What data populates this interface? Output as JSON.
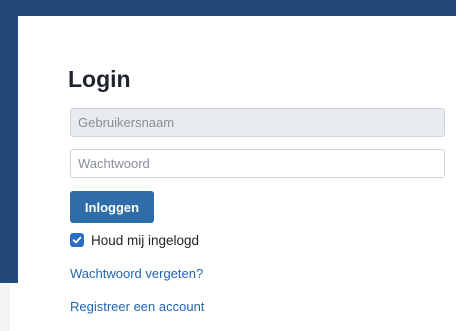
{
  "login": {
    "title": "Login",
    "username_placeholder": "Gebruikersnaam",
    "username_value": "",
    "password_placeholder": "Wachtwoord",
    "password_value": "",
    "submit_label": "Inloggen",
    "remember_label": "Houd mij ingelogd",
    "remember_checked": true,
    "forgot_link": "Wachtwoord vergeten?",
    "register_link": "Registreer een account"
  },
  "icons": {
    "checkbox_check": "check-icon"
  },
  "colors": {
    "frame": "#22497a",
    "button": "#2f6da8",
    "checkbox": "#2b6ec6",
    "link": "#2266b2",
    "title": "#1f2430"
  }
}
